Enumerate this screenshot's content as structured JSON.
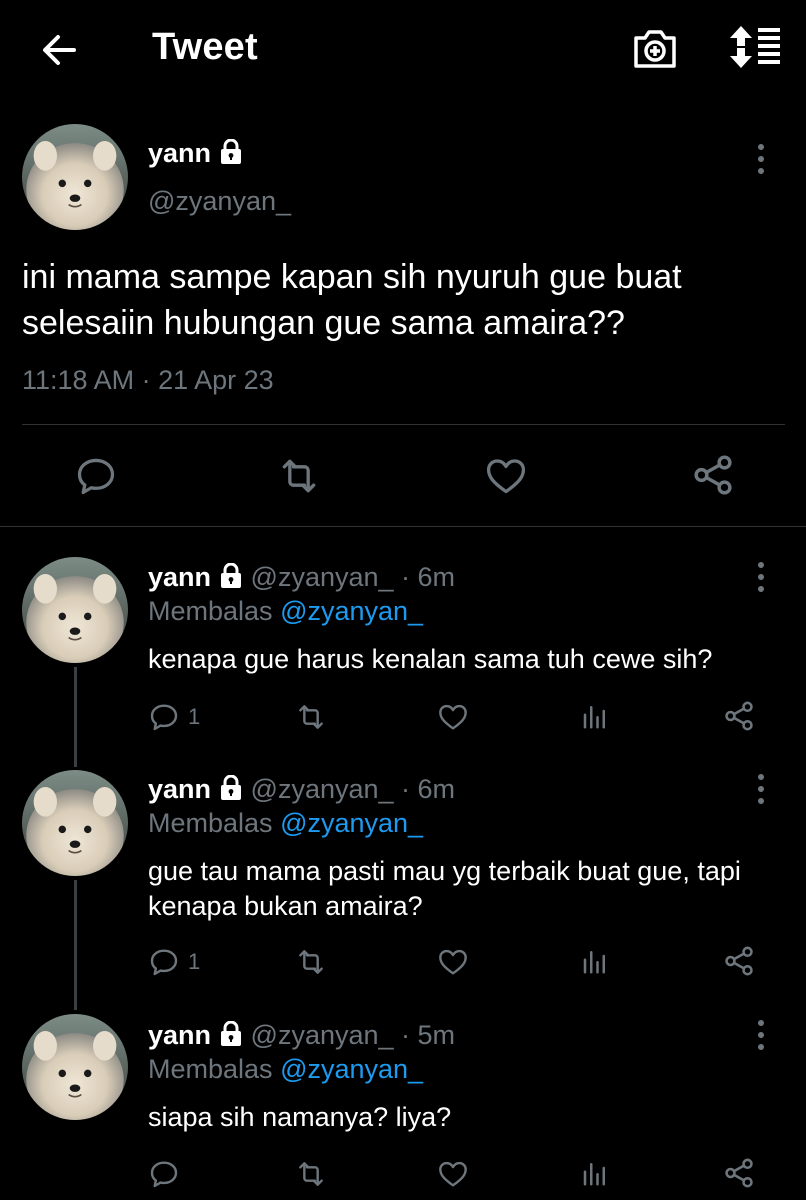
{
  "header": {
    "title": "Tweet"
  },
  "main_tweet": {
    "name": "yann",
    "handle": "@zyanyan_",
    "text": "ini mama sampe kapan sih nyuruh gue buat selesaiin hubungan gue sama amaira??",
    "timestamp": "11:18 AM · 21 Apr 23"
  },
  "replies": [
    {
      "name": "yann",
      "handle_time": "@zyanyan_ · 6m",
      "replying_label": "Membalas",
      "replying_to": "@zyanyan_",
      "text": "kenapa gue harus kenalan sama tuh cewe sih?",
      "reply_count": "1"
    },
    {
      "name": "yann",
      "handle_time": "@zyanyan_ · 6m",
      "replying_label": "Membalas",
      "replying_to": "@zyanyan_",
      "text": "gue tau mama pasti mau yg terbaik buat gue, tapi kenapa bukan amaira?",
      "reply_count": "1"
    },
    {
      "name": "yann",
      "handle_time": "@zyanyan_ · 5m",
      "replying_label": "Membalas",
      "replying_to": "@zyanyan_",
      "text": "siapa sih namanya? liya?",
      "reply_count": ""
    }
  ],
  "colors": {
    "background": "#000000",
    "muted": "#6e767d",
    "link": "#1d9bf0",
    "divider": "#2f3336"
  },
  "icons": [
    "back-arrow-icon",
    "camera-plus-icon",
    "sort-icon",
    "lock-icon",
    "more-icon",
    "reply-icon",
    "retweet-icon",
    "like-icon",
    "share-icon",
    "analytics-icon"
  ]
}
